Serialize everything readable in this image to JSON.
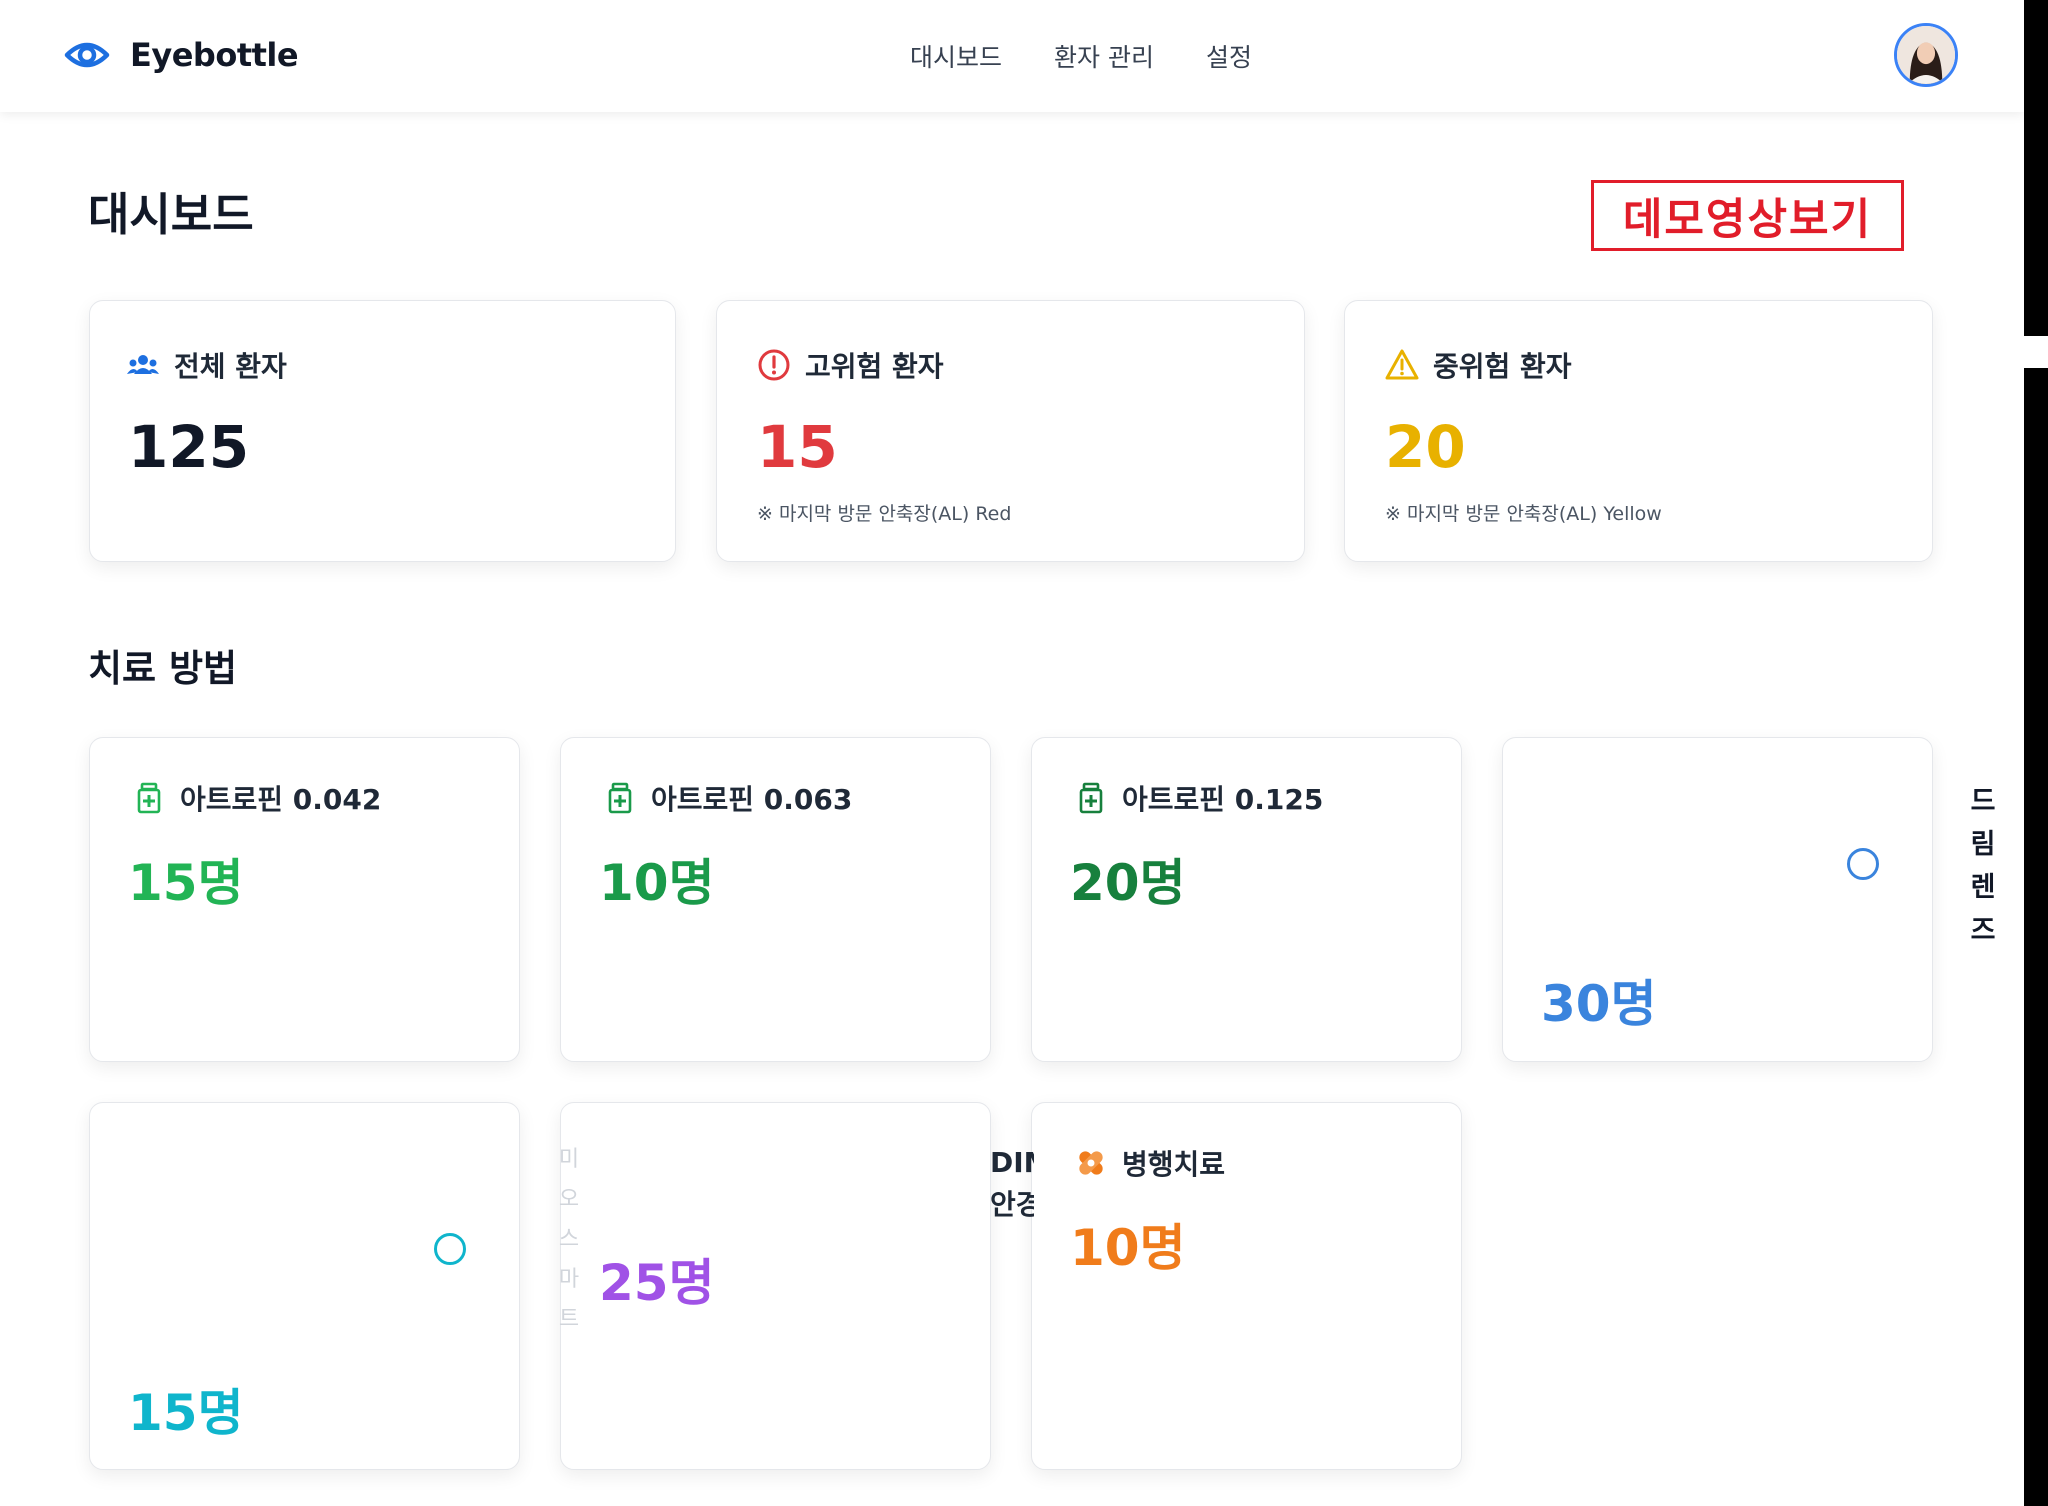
{
  "app": {
    "name": "Eyebottle"
  },
  "nav": [
    {
      "label": "대시보드"
    },
    {
      "label": "환자 관리"
    },
    {
      "label": "설정"
    }
  ],
  "page": {
    "title": "대시보드",
    "demo_button": "데모영상보기"
  },
  "summary": {
    "total": {
      "label": "전체 환자",
      "value": "125"
    },
    "high": {
      "label": "고위험 환자",
      "value": "15",
      "note": "※ 마지막 방문 안축장(AL) Red"
    },
    "medium": {
      "label": "중위험 환자",
      "value": "20",
      "note": "※ 마지막 방문 안축장(AL) Yellow"
    }
  },
  "treatments": {
    "title": "치료 방법",
    "items": [
      {
        "label": "아트로핀 0.042",
        "count": "15명"
      },
      {
        "label": "아트로핀 0.063",
        "count": "10명"
      },
      {
        "label": "아트로핀 0.125",
        "count": "20명"
      },
      {
        "label": "",
        "count": "30명"
      },
      {
        "label": "",
        "count": "15명"
      },
      {
        "label": "",
        "count": "25명"
      },
      {
        "label": "병행치료",
        "count": "10명"
      }
    ],
    "side_label": [
      "드",
      "림",
      "렌",
      "즈"
    ],
    "faded_label": [
      "미",
      "오",
      "스",
      "마",
      "트"
    ],
    "overflow_label": [
      "DIMS",
      "안경"
    ]
  },
  "colors": {
    "accent_blue": "#1d6fe0",
    "danger": "#e03a3e",
    "warning": "#e8b100",
    "green_1": "#22b455",
    "green_2": "#1a9a4a",
    "green_3": "#17803d",
    "blue_count": "#3a84dd",
    "cyan_count": "#0fb5cc",
    "purple_count": "#a052e6",
    "orange_count": "#f07c1b"
  },
  "icons": {
    "logo": "eye-icon",
    "total": "users-icon",
    "high": "alert-circle-icon",
    "medium": "warning-triangle-icon",
    "atropine": "medicine-bottle-icon",
    "combination": "bandage-icon"
  }
}
